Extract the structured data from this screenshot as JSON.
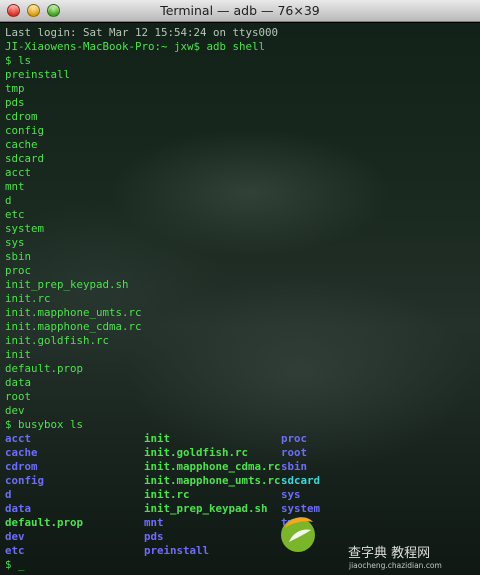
{
  "window": {
    "title": "Terminal — adb — 76×39"
  },
  "terminal": {
    "lines": [
      "Last login: Sat Mar 12 15:54:24 on ttys000",
      "JI-Xiaowens-MacBook-Pro:~ jxw$ adb shell",
      "$ ls",
      "preinstall",
      "tmp",
      "pds",
      "cdrom",
      "config",
      "cache",
      "sdcard",
      "acct",
      "mnt",
      "d",
      "etc",
      "system",
      "sys",
      "sbin",
      "proc",
      "init_prep_keypad.sh",
      "init.rc",
      "init.mapphone_umts.rc",
      "init.mapphone_cdma.rc",
      "init.goldfish.rc",
      "init",
      "default.prop",
      "data",
      "root",
      "dev",
      "$ busybox ls"
    ],
    "busybox_columns": [
      [
        {
          "name": "acct",
          "type": "dir"
        },
        {
          "name": "cache",
          "type": "dir"
        },
        {
          "name": "cdrom",
          "type": "dir"
        },
        {
          "name": "config",
          "type": "dir"
        },
        {
          "name": "d",
          "type": "dir"
        },
        {
          "name": "data",
          "type": "dir"
        },
        {
          "name": "default.prop",
          "type": "file"
        },
        {
          "name": "dev",
          "type": "dir"
        },
        {
          "name": "etc",
          "type": "dir"
        }
      ],
      [
        {
          "name": "init",
          "type": "file"
        },
        {
          "name": "init.goldfish.rc",
          "type": "file"
        },
        {
          "name": "init.mapphone_cdma.rc",
          "type": "file"
        },
        {
          "name": "init.mapphone_umts.rc",
          "type": "file"
        },
        {
          "name": "init.rc",
          "type": "file"
        },
        {
          "name": "init_prep_keypad.sh",
          "type": "file"
        },
        {
          "name": "mnt",
          "type": "dir"
        },
        {
          "name": "pds",
          "type": "dir"
        },
        {
          "name": "preinstall",
          "type": "dir"
        }
      ],
      [
        {
          "name": "proc",
          "type": "dir"
        },
        {
          "name": "root",
          "type": "dir"
        },
        {
          "name": "sbin",
          "type": "dir"
        },
        {
          "name": "sdcard",
          "type": "link"
        },
        {
          "name": "sys",
          "type": "dir"
        },
        {
          "name": "system",
          "type": "dir"
        },
        {
          "name": "tmp",
          "type": "dir"
        }
      ]
    ],
    "current_prompt": "$ _"
  },
  "colors": {
    "text": "#4ee04e",
    "directory": "#6d6df7",
    "symlink": "#39d7d7"
  },
  "watermark": {
    "logo_icon": "leaf-logo",
    "brand": "查字典 教程网",
    "url": "jiaocheng.chazidian.com"
  }
}
